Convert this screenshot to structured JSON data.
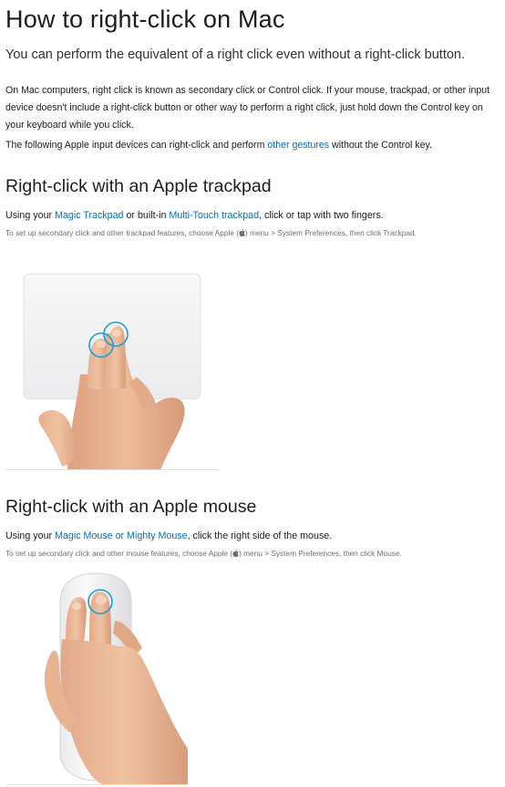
{
  "title": "How to right-click on Mac",
  "intro": "You can perform the equivalent of a right click even without a right-click button.",
  "para1": "On Mac computers, right click is known as secondary click or Control click. If your mouse, trackpad, or other input device doesn't include a right-click button or other way to perform a right click, just hold down the Control key on your keyboard while you click.",
  "para2": {
    "before": "The following Apple input devices can right-click and perform ",
    "link": "other gestures",
    "after": " without the Control key."
  },
  "trackpad_section": {
    "heading": "Right-click with an Apple trackpad",
    "line_before": "Using your ",
    "link1": "Magic Trackpad",
    "line_mid": " or built-in ",
    "link2": "Multi-Touch trackpad",
    "line_after": ", click or tap with two fingers.",
    "note_before": "To set up secondary click and other trackpad features, choose Apple (",
    "note_after": ") menu > System Preferences, then click Trackpad."
  },
  "mouse_section": {
    "heading": "Right-click with an Apple mouse",
    "line_before": "Using your ",
    "link1": "Magic Mouse or Mighty Mouse",
    "line_after": ", click the right side of the mouse.",
    "note_before": "To set up secondary click and other mouse features, choose Apple (",
    "note_after": ") menu > System Preferences, then click Mouse."
  },
  "colors": {
    "link": "#0070c9",
    "text": "#1d1d1f",
    "note": "#6e6e73",
    "touch_ring": "#1a9fd9"
  },
  "icons": {
    "apple_menu": "apple-logo-icon"
  }
}
